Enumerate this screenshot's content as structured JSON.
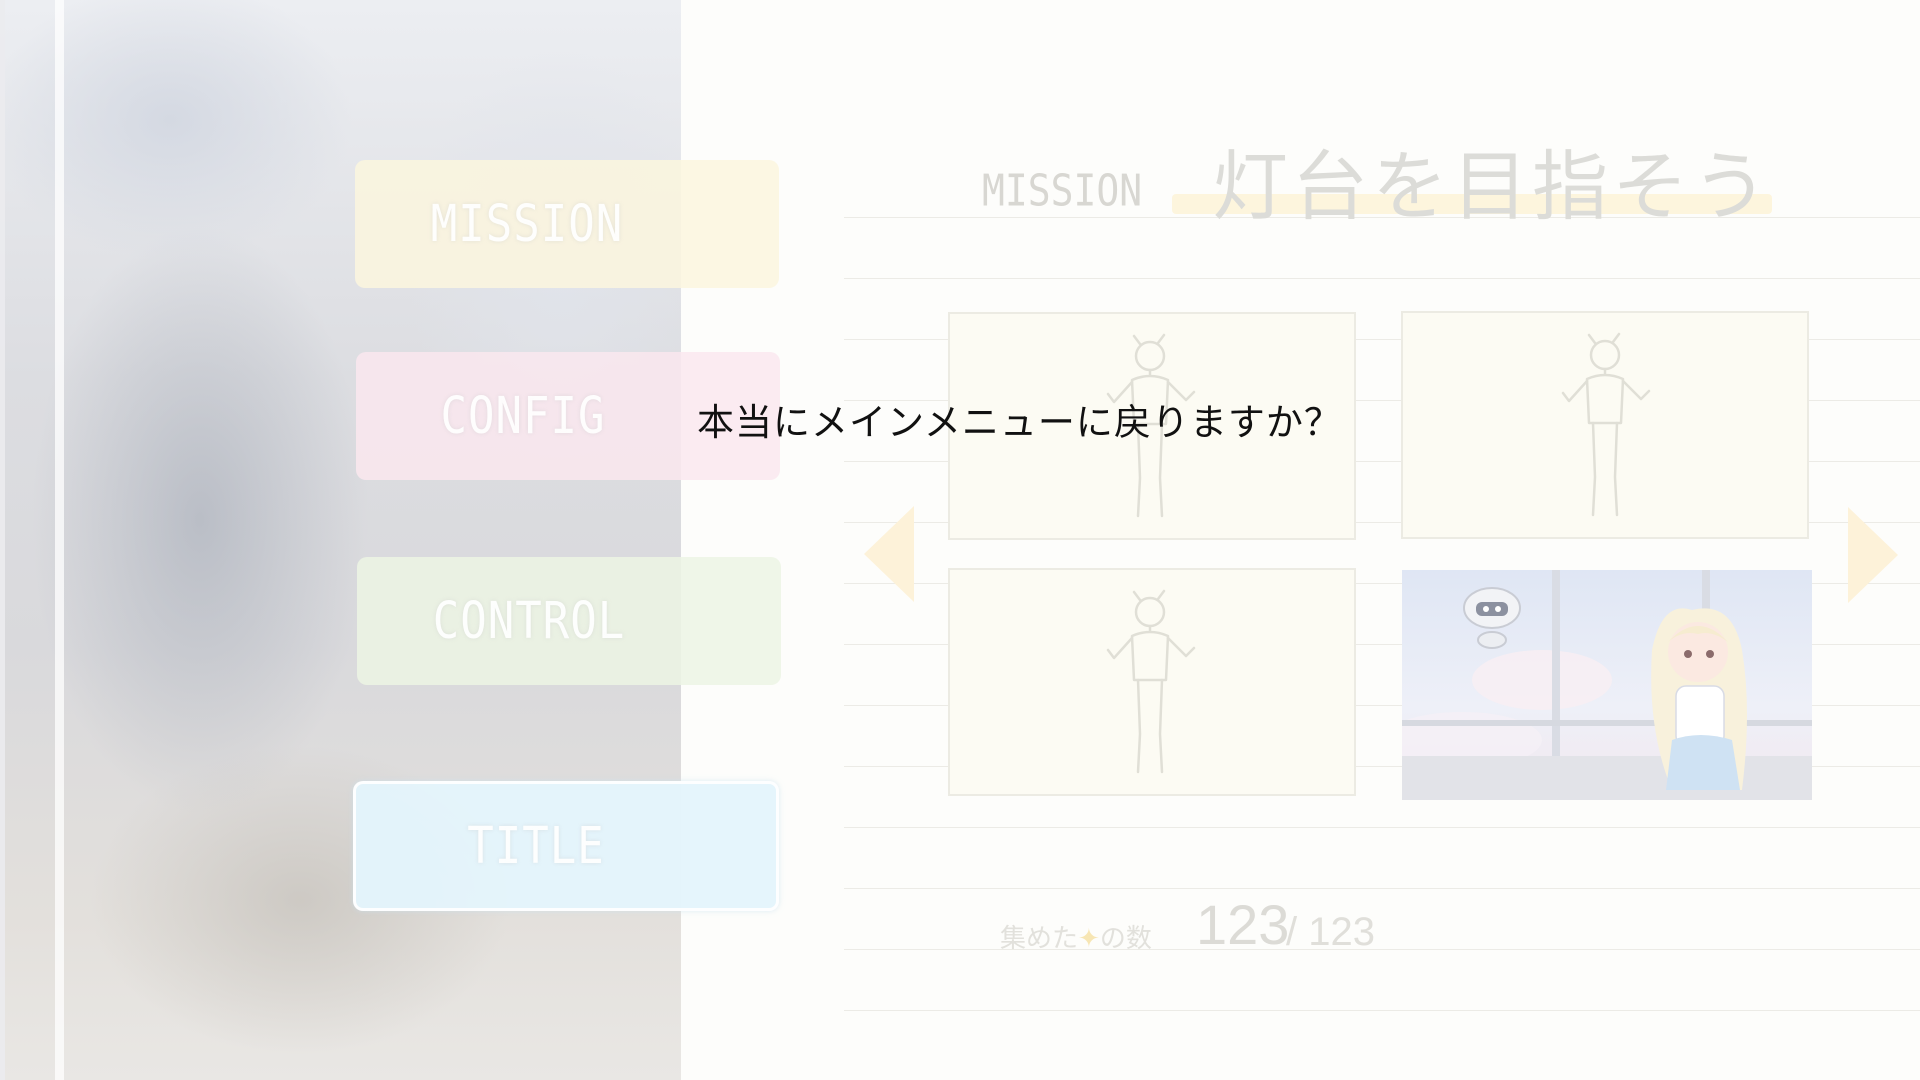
{
  "menu": {
    "mission_label": "MISSION",
    "config_label": "CONFIG",
    "control_label": "CONTROL",
    "title_label": "TITLE"
  },
  "mission": {
    "label": "MISSION",
    "title": "灯台を目指そう"
  },
  "gallery": {
    "thumbnails": [
      {
        "state": "locked",
        "icon": "character-silhouette-icon"
      },
      {
        "state": "locked",
        "icon": "character-silhouette-icon"
      },
      {
        "state": "locked",
        "icon": "character-silhouette-icon"
      },
      {
        "state": "unlocked",
        "icon": "character-illustration"
      }
    ],
    "prev_icon": "arrow-left-icon",
    "next_icon": "arrow-right-icon"
  },
  "collection": {
    "label_before": "集めた",
    "label_star": "✦",
    "label_after": "の数",
    "count": "123",
    "total": "/ 123"
  },
  "dialog": {
    "message": "本当にメインメニューに戻りますか？"
  },
  "colors": {
    "accent_yellow": "#fdf2d9",
    "mission_btn": "#fcf6de",
    "config_btn": "#fae8ee",
    "control_btn": "#ecf4e4",
    "title_btn": "#e4f4fc"
  }
}
